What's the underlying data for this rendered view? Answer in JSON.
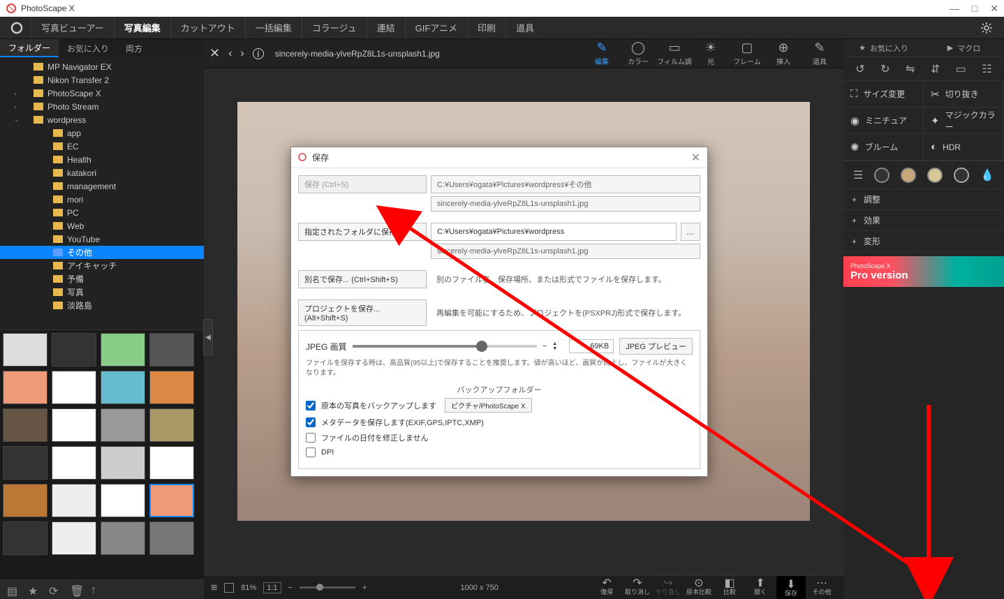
{
  "app": {
    "title": "PhotoScape X"
  },
  "window_controls": {
    "min": "—",
    "max": "□",
    "close": "✕"
  },
  "main_tabs": [
    "写真ビューアー",
    "写真編集",
    "カットアウト",
    "一括編集",
    "コラージュ",
    "連結",
    "GIFアニメ",
    "印刷",
    "道具"
  ],
  "main_tab_active": 1,
  "sub_tabs": [
    "フォルダー",
    "お気に入り",
    "両方"
  ],
  "sub_tab_active": 0,
  "tree": [
    {
      "label": "MP Navigator EX",
      "sub": false
    },
    {
      "label": "Nikon Transfer 2",
      "sub": false
    },
    {
      "label": "PhotoScape X",
      "sub": false,
      "chev": "›"
    },
    {
      "label": "Photo Stream",
      "sub": false,
      "chev": "›"
    },
    {
      "label": "wordpress",
      "sub": false,
      "chev": "⌄"
    },
    {
      "label": "app",
      "sub": true
    },
    {
      "label": "EC",
      "sub": true
    },
    {
      "label": "Health",
      "sub": true
    },
    {
      "label": "katakori",
      "sub": true
    },
    {
      "label": "management",
      "sub": true
    },
    {
      "label": "mori",
      "sub": true
    },
    {
      "label": "PC",
      "sub": true
    },
    {
      "label": "Web",
      "sub": true
    },
    {
      "label": "YouTube",
      "sub": true
    },
    {
      "label": "その他",
      "sub": true,
      "sel": true
    },
    {
      "label": "アイキャッチ",
      "sub": true
    },
    {
      "label": "予備",
      "sub": true
    },
    {
      "label": "写真",
      "sub": true
    },
    {
      "label": "淡路島",
      "sub": true
    }
  ],
  "topbar": {
    "filename": "sincerely-media-ylveRpZ8L1s-unsplash1.jpg",
    "tools": [
      {
        "label": "編集",
        "active": true
      },
      {
        "label": "カラー"
      },
      {
        "label": "フィルム調"
      },
      {
        "label": "光"
      },
      {
        "label": "フレーム"
      },
      {
        "label": "挿入"
      },
      {
        "label": "道具"
      }
    ]
  },
  "right_panel": {
    "fav": "お気に入り",
    "macro": "マクロ",
    "tools": [
      {
        "l": "サイズ変更"
      },
      {
        "l": "切り抜き"
      },
      {
        "l": "ミニチュア"
      },
      {
        "l": "マジックカラー"
      },
      {
        "l": "ブルーム"
      },
      {
        "l": "HDR"
      }
    ],
    "adds": [
      "調整",
      "効果",
      "変形"
    ],
    "promo": "Pro version",
    "promo_brand": "PhotoScape X"
  },
  "bottombar": {
    "zoom": "81%",
    "ratio": "1:1",
    "dims": "1000 x 750",
    "actions": [
      "復帰",
      "取り消し",
      "やり直し",
      "原本比較",
      "比較",
      "開く",
      "保存",
      "その他"
    ]
  },
  "dialog": {
    "title": "保存",
    "save_btn_disabled": "保存   (Ctrl+S)",
    "path1": "C:¥Users¥ogata¥Pictures¥wordpress¥その他",
    "file1": "sincerely-media-ylveRpZ8L1s-unsplash1.jpg",
    "specified_folder_btn": "指定されたフォルダに保存",
    "path2": "C:¥Users¥ogata¥Pictures¥wordpress",
    "file2": "sincerely-media-ylveRpZ8L1s-unsplash1.jpg",
    "saveas_btn": "別名で保存...   (Ctrl+Shift+S)",
    "saveas_desc": "別のファイル名、保存場所、または形式でファイルを保存します。",
    "project_btn": "プロジェクトを保存...   (Alt+Shift+S)",
    "project_desc": "再編集を可能にするため、プロジェクトを(PSXPRJ)形式で保存します。",
    "jpeg_label": "JPEG 画質",
    "jpeg_size": "69KB",
    "jpeg_preview": "JPEG プレビュー",
    "jpeg_note": "ファイルを保存する時は、高品質(95以上)で保存することを推奨します。値が高いほど、画質が向上し、ファイルが大きくなります。",
    "backup_label": "バックアップフォルダー",
    "chk_backup": "原本の写真をバックアップします",
    "backup_btn": "ピクチャ/PhotoScape X",
    "chk_meta": "メタデータを保存します(EXIF,GPS,IPTC,XMP)",
    "chk_date": "ファイルの日付を修正しません",
    "chk_dpi": "DPI"
  }
}
